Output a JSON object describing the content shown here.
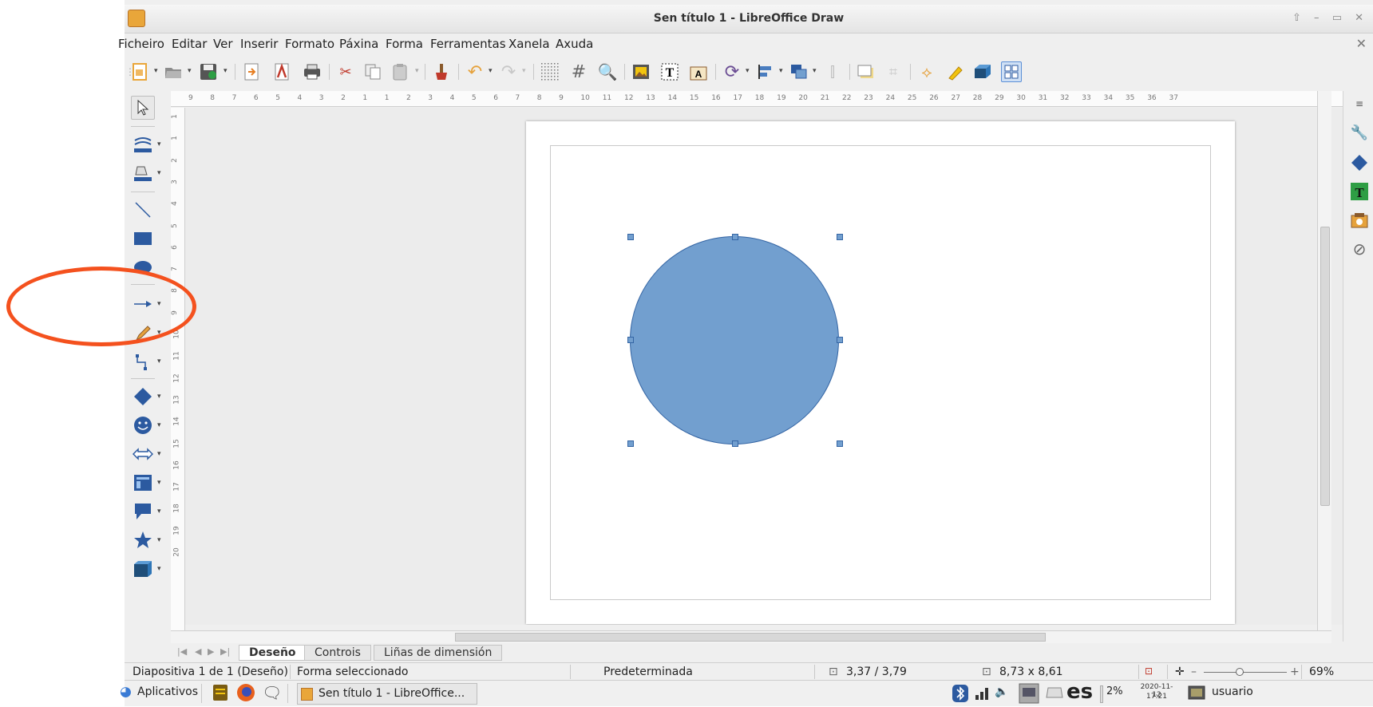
{
  "window": {
    "title": "Sen título 1 - LibreOffice Draw",
    "controls": "⇧ – ▭ ✕"
  },
  "menu": [
    "Ficheiro",
    "Editar",
    "Ver",
    "Inserir",
    "Formato",
    "Páxina",
    "Forma",
    "Ferramentas",
    "Xanela",
    "Axuda"
  ],
  "menu_close": "✕",
  "ruler": {
    "h_ticks": [
      "9",
      "8",
      "7",
      "6",
      "5",
      "4",
      "3",
      "2",
      "1",
      "1",
      "2",
      "3",
      "4",
      "5",
      "6",
      "7",
      "8",
      "9",
      "10",
      "11",
      "12",
      "13",
      "14",
      "15",
      "16",
      "17",
      "18",
      "19",
      "20",
      "21",
      "22",
      "23",
      "24",
      "25",
      "26",
      "27",
      "28",
      "29",
      "30",
      "31",
      "32",
      "33",
      "34",
      "35",
      "36",
      "37"
    ],
    "v_ticks": [
      "1",
      "1",
      "2",
      "3",
      "4",
      "5",
      "6",
      "7",
      "8",
      "9",
      "10",
      "11",
      "12",
      "13",
      "14",
      "15",
      "16",
      "17",
      "18",
      "19",
      "20"
    ]
  },
  "tabs": [
    "Deseño",
    "Controis",
    "Liñas de dimensión"
  ],
  "status": {
    "slide": "Diapositiva 1 de 1 (Deseño)",
    "selection": "Forma seleccionado",
    "master": "Predeterminada",
    "position": "3,37 / 3,79",
    "size": "8,73 x 8,61",
    "zoom": "69%"
  },
  "taskbar": {
    "apps_label": "Aplicativos",
    "window_label": "Sen título 1 - LibreOffice...",
    "keyboard": "es",
    "battery": "2%",
    "date": "2020-11-12",
    "time": "17:21",
    "user": "usuario"
  },
  "colors": {
    "shape_fill": "#729fcf",
    "shape_stroke": "#3465a4",
    "annotation": "#f4511e"
  }
}
